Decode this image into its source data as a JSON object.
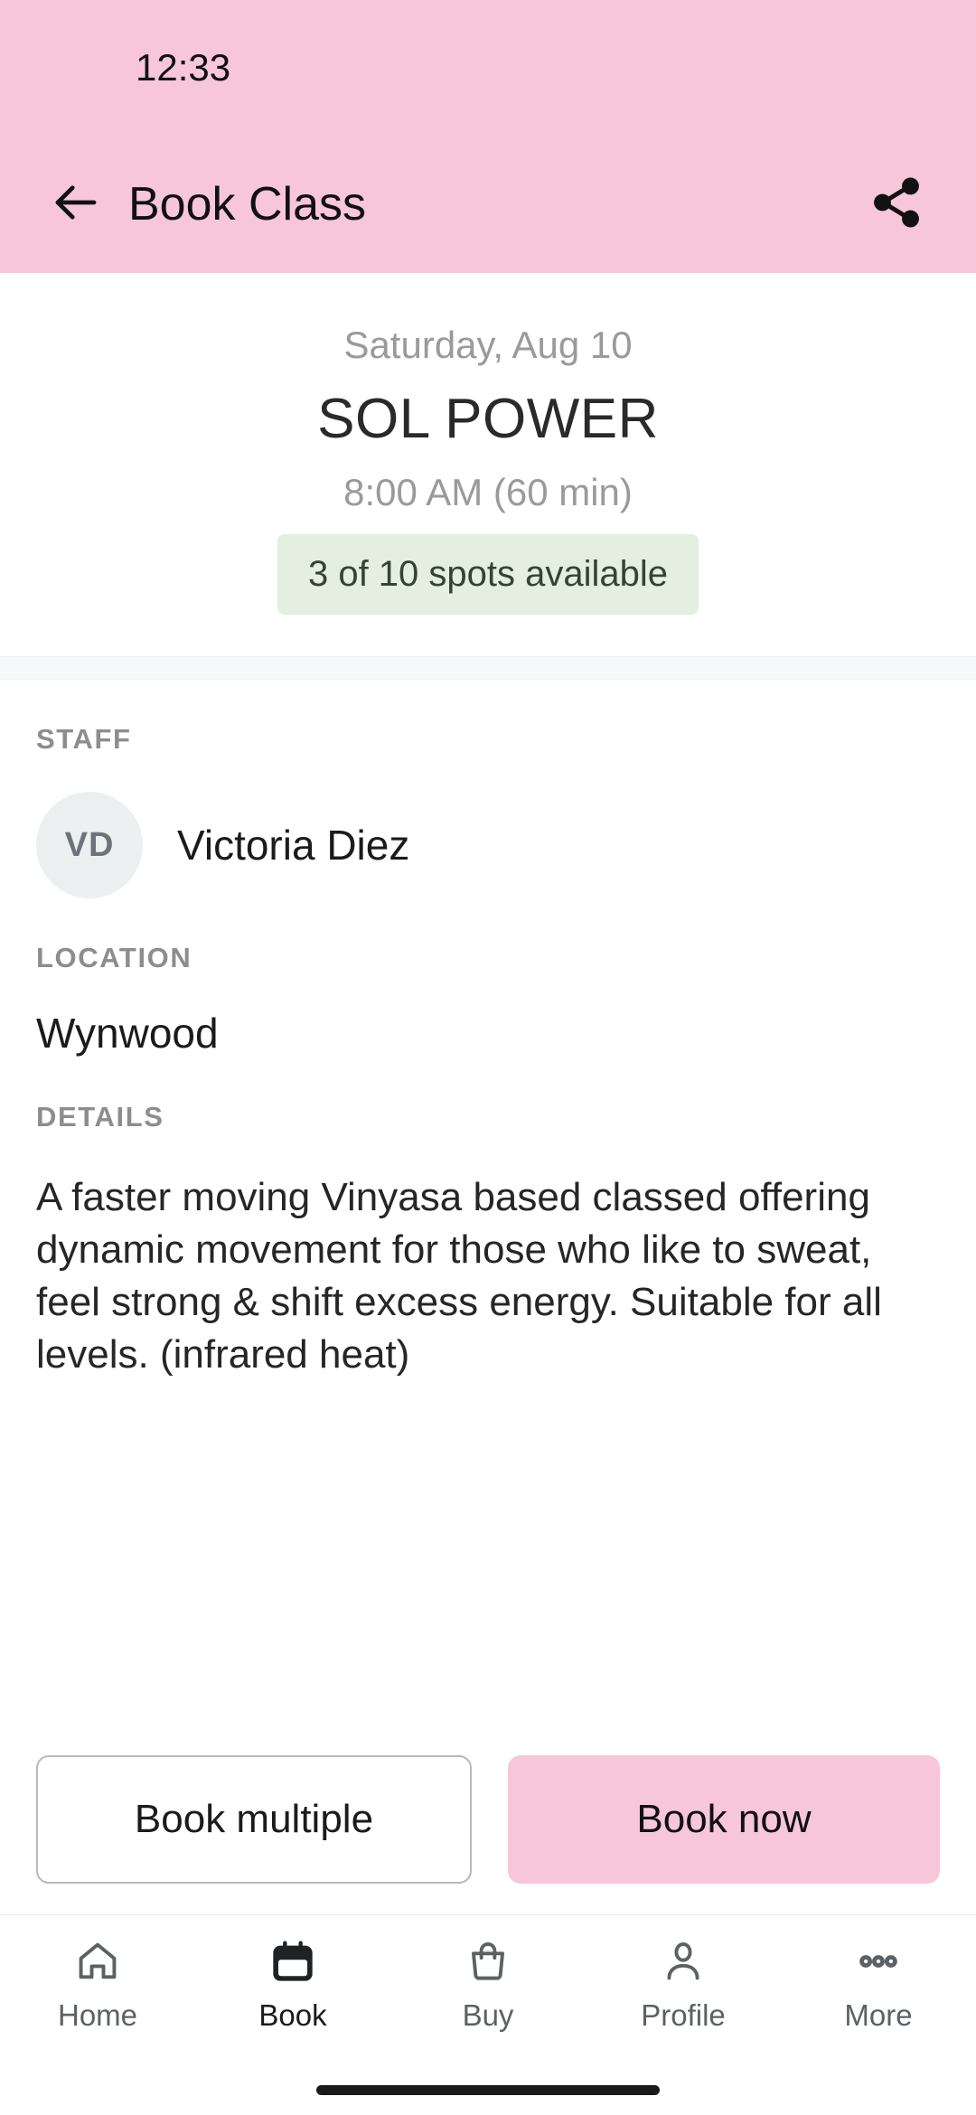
{
  "status_bar": {
    "clock": "12:33"
  },
  "app_bar": {
    "title": "Book Class",
    "back_icon": "arrow-left-icon",
    "share_icon": "share-icon"
  },
  "hero": {
    "date": "Saturday, Aug 10",
    "class_name": "SOL POWER",
    "time": "8:00 AM (60 min)",
    "spots": "3 of 10 spots available"
  },
  "sections": {
    "staff_label": "STAFF",
    "staff_initials": "VD",
    "staff_name": "Victoria Diez",
    "location_label": "LOCATION",
    "location_value": "Wynwood",
    "details_label": "DETAILS",
    "details_text": "A faster moving Vinyasa based classed offering dynamic movement for those who like to sweat, feel strong & shift excess energy. Suitable for all levels. (infrared heat)"
  },
  "actions": {
    "book_multiple": "Book multiple",
    "book_now": "Book now"
  },
  "bottom_nav": {
    "items": [
      {
        "label": "Home",
        "icon": "home-icon",
        "active": false
      },
      {
        "label": "Book",
        "icon": "calendar-icon",
        "active": true
      },
      {
        "label": "Buy",
        "icon": "shopping-bag-icon",
        "active": false
      },
      {
        "label": "Profile",
        "icon": "person-icon",
        "active": false
      },
      {
        "label": "More",
        "icon": "ellipsis-icon",
        "active": false
      }
    ]
  },
  "colors": {
    "brand_pink": "#F7C6D9",
    "badge_green_bg": "#E4EFE1",
    "badge_green_text": "#33452F",
    "avatar_bg": "#ECF0F1",
    "muted_text": "#9A9A9A"
  }
}
